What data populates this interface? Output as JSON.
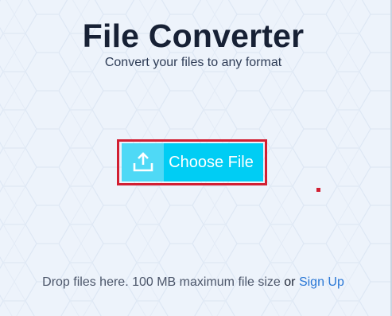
{
  "header": {
    "title": "File Converter",
    "subtitle": "Convert your files to any format"
  },
  "upload": {
    "button_label": "Choose File",
    "icon": "upload-icon"
  },
  "footer": {
    "drop_text": "Drop files here. 100 MB maximum file size",
    "or_text": "or",
    "signup_label": "Sign Up"
  },
  "colors": {
    "background": "#edf3fb",
    "title": "#172135",
    "button_icon_bg": "#4fd9f6",
    "button_bg": "#00cdf4",
    "highlight": "#d21f32",
    "link": "#2b78d6"
  }
}
